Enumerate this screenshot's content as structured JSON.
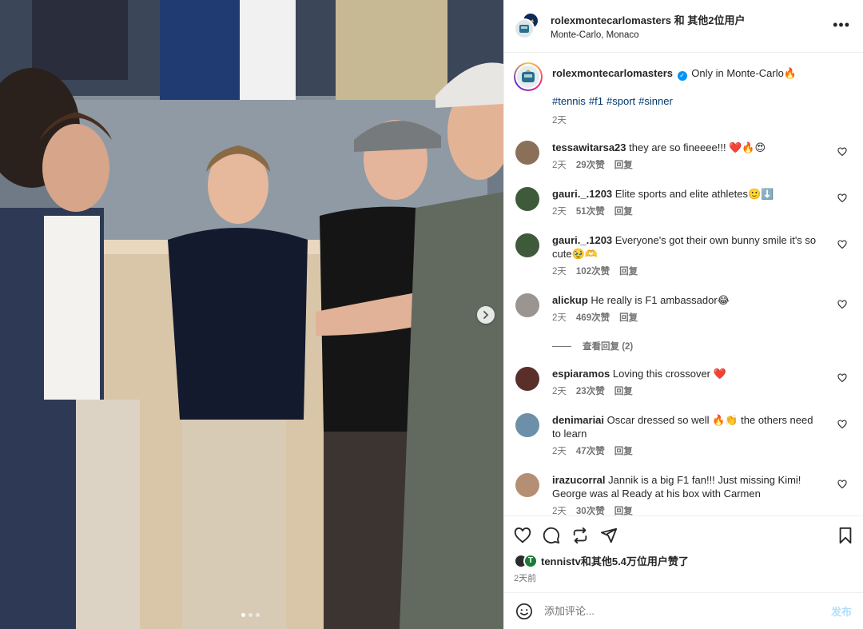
{
  "post": {
    "header": {
      "title": "rolexmontecarlomasters 和 其他2位用户",
      "location": "Monte-Carlo, Monaco"
    },
    "caption": {
      "username": "rolexmontecarlomasters",
      "text": "Only in Monte-Carlo🔥",
      "hashtags": [
        "#tennis",
        "#f1",
        "#sport",
        "#sinner"
      ],
      "age": "2天"
    },
    "comments": [
      {
        "username": "tessawitarsa23",
        "text": "they are so fineeee!!! ❤️🔥😍",
        "age": "2天",
        "likes": "29次赞",
        "reply": "回复",
        "avatar_color": "#8a7058"
      },
      {
        "username": "gauri._.1203",
        "text": "Elite sports and elite athletes🙂⬇️",
        "age": "2天",
        "likes": "51次赞",
        "reply": "回复",
        "avatar_color": "#3f5a3a"
      },
      {
        "username": "gauri._.1203",
        "text": "Everyone's got their own bunny smile it's so cute🥹🫶",
        "age": "2天",
        "likes": "102次赞",
        "reply": "回复",
        "avatar_color": "#3f5a3a"
      },
      {
        "username": "alickup",
        "text": "He really is F1 ambassador😂",
        "age": "2天",
        "likes": "469次赞",
        "reply": "回复",
        "avatar_color": "#9a9590"
      },
      {
        "username": "espiaramos",
        "text": "Loving this crossover ❤️",
        "age": "2天",
        "likes": "23次赞",
        "reply": "回复",
        "avatar_color": "#5a2f2a"
      },
      {
        "username": "denimariai",
        "text": "Oscar dressed so well 🔥👏 the others need to learn",
        "age": "2天",
        "likes": "47次赞",
        "reply": "回复",
        "avatar_color": "#6d8fa8"
      },
      {
        "username": "irazucorral",
        "text": "Jannik is a big F1 fan!!! Just missing Kimi! George was al Ready at his box with Carmen",
        "age": "2天",
        "likes": "30次赞",
        "reply": "回复",
        "avatar_color": "#b58f73"
      }
    ],
    "view_replies": "查看回复 (2)",
    "likes_summary": {
      "user": "tennistv",
      "rest": "和其他5.4万位用户赞了",
      "avatar_letter": "T"
    },
    "post_age": "2天前",
    "add_comment": {
      "placeholder": "添加评论...",
      "post_label": "发布"
    },
    "carousel": {
      "total": 3,
      "current": 1
    },
    "colors": {
      "accent": "#0095f6",
      "hashtag": "#00376b",
      "muted": "#737373"
    }
  }
}
